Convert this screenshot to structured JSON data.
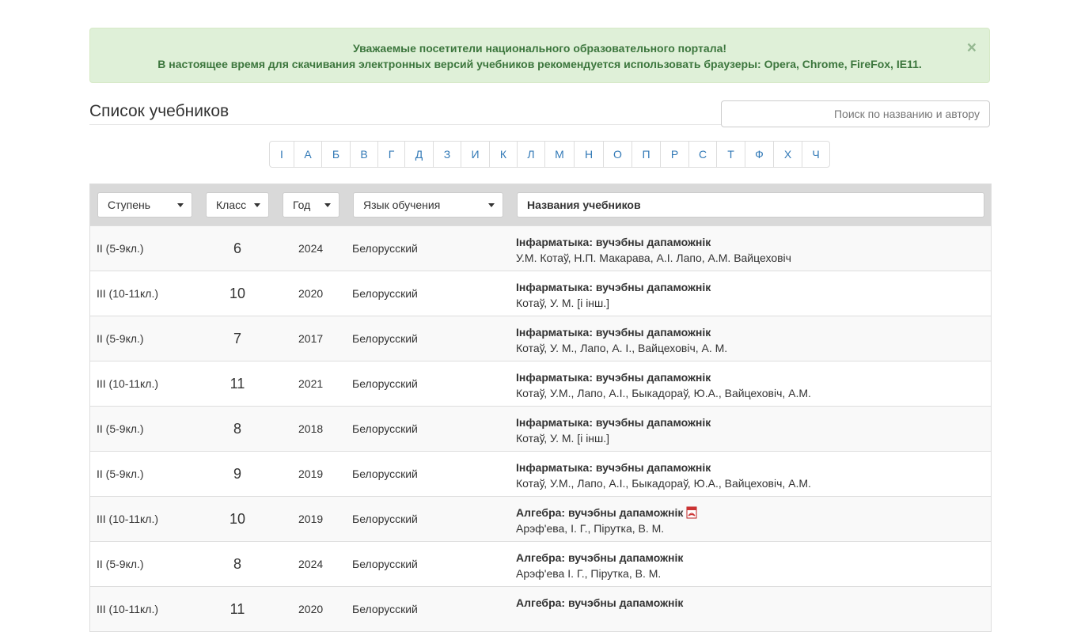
{
  "alert": {
    "line1": "Уважаемые посетители национального образовательного портала!",
    "line2": "В настоящее время для скачивания электронных версий учебников рекомендуется использовать браузеры: Opera, Chrome, FireFox, IE11.",
    "close": "×"
  },
  "page": {
    "title": "Список учебников"
  },
  "search": {
    "placeholder": "Поиск по названию и автору"
  },
  "letters": [
    "І",
    "А",
    "Б",
    "В",
    "Г",
    "Д",
    "З",
    "И",
    "К",
    "Л",
    "М",
    "Н",
    "О",
    "П",
    "Р",
    "С",
    "Т",
    "Ф",
    "Х",
    "Ч"
  ],
  "filters": {
    "step": "Ступень",
    "grade": "Класс",
    "year": "Год",
    "language": "Язык обучения",
    "names": "Названия учебников"
  },
  "rows": [
    {
      "step": "II (5-9кл.)",
      "grade": "6",
      "year": "2024",
      "lang": "Белорусский",
      "title": "Інфарматыка: вучэбны дапаможнік",
      "authors": "У.М. Котаў, Н.П. Макарава, А.І. Лапо, А.М. Вайцеховіч",
      "pdf": false
    },
    {
      "step": "III (10-11кл.)",
      "grade": "10",
      "year": "2020",
      "lang": "Белорусский",
      "title": "Інфарматыка: вучэбны дапаможнік",
      "authors": "Котаў, У. М. [і інш.]",
      "pdf": false
    },
    {
      "step": "II (5-9кл.)",
      "grade": "7",
      "year": "2017",
      "lang": "Белорусский",
      "title": "Інфарматыка: вучэбны дапаможнік",
      "authors": "Котаў, У. М., Лапо, А. І., Вайцеховіч, А. М.",
      "pdf": false
    },
    {
      "step": "III (10-11кл.)",
      "grade": "11",
      "year": "2021",
      "lang": "Белорусский",
      "title": "Інфарматыка: вучэбны дапаможнік",
      "authors": "Котаў, У.М., Лапо, А.І., Быкадораў, Ю.А., Вайцеховіч, А.М.",
      "pdf": false
    },
    {
      "step": "II (5-9кл.)",
      "grade": "8",
      "year": "2018",
      "lang": "Белорусский",
      "title": "Інфарматыка: вучэбны дапаможнік",
      "authors": "Котаў, У. М. [і інш.]",
      "pdf": false
    },
    {
      "step": "II (5-9кл.)",
      "grade": "9",
      "year": "2019",
      "lang": "Белорусский",
      "title": "Інфарматыка: вучэбны дапаможнік",
      "authors": "Котаў, У.М., Лапо, А.І., Быкадораў, Ю.А., Вайцеховіч, А.М.",
      "pdf": false
    },
    {
      "step": "III (10-11кл.)",
      "grade": "10",
      "year": "2019",
      "lang": "Белорусский",
      "title": "Алгебра: вучэбны дапаможнік",
      "authors": "Арэф'ева, І. Г., Пірутка, В. М.",
      "pdf": true
    },
    {
      "step": "II (5-9кл.)",
      "grade": "8",
      "year": "2024",
      "lang": "Белорусский",
      "title": "Алгебра: вучэбны дапаможнік",
      "authors": "Арэф'ева І. Г., Пірутка, В. М.",
      "pdf": false
    },
    {
      "step": "III (10-11кл.)",
      "grade": "11",
      "year": "2020",
      "lang": "Белорусский",
      "title": "Алгебра: вучэбны дапаможнік",
      "authors": "",
      "pdf": false
    }
  ],
  "icons": {
    "pdf": "pdf-file-icon",
    "caret": "chevron-down-icon",
    "close": "close-icon"
  },
  "colors": {
    "alert_bg": "#dff0d8",
    "alert_text": "#3c763d",
    "link": "#337ab7",
    "header_bg": "#d9d9d9"
  }
}
